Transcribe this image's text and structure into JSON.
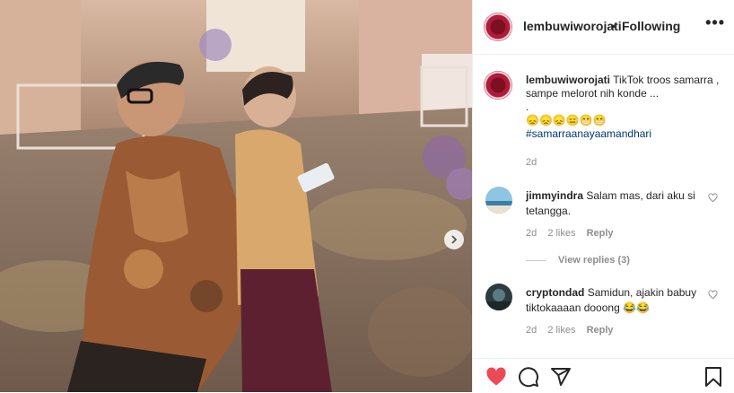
{
  "post": {
    "username": "lembuwiworojati",
    "separator": "•",
    "follow_status": "Following",
    "more_glyph": "•••",
    "caption_text": "TikTok troos samarra , sampe melorot nih konde ...",
    "caption_dot": ".",
    "caption_emojis": "😞😞😞😑😁😁",
    "hashtag": "#samarraanayaamandhari",
    "date": "2d"
  },
  "comments": [
    {
      "username": "jimmyindra",
      "text": "Salam mas, dari aku si tetangga.",
      "time": "2d",
      "likes": "2 likes",
      "reply": "Reply"
    },
    {
      "username": "cryptondad",
      "text": "Samidun, ajakin babuy tiktokaaaan dooong 😂😂",
      "time": "2d",
      "likes": "2 likes",
      "reply": "Reply"
    }
  ],
  "view_replies": "View replies (3)",
  "colors": {
    "like_red": "#ed4956",
    "link_blue": "#00376b",
    "muted": "#8e8e8e"
  },
  "icons": [
    "heart-filled-icon",
    "comment-icon",
    "share-icon",
    "bookmark-icon",
    "more-icon",
    "chevron-right-icon",
    "heart-outline-icon"
  ]
}
